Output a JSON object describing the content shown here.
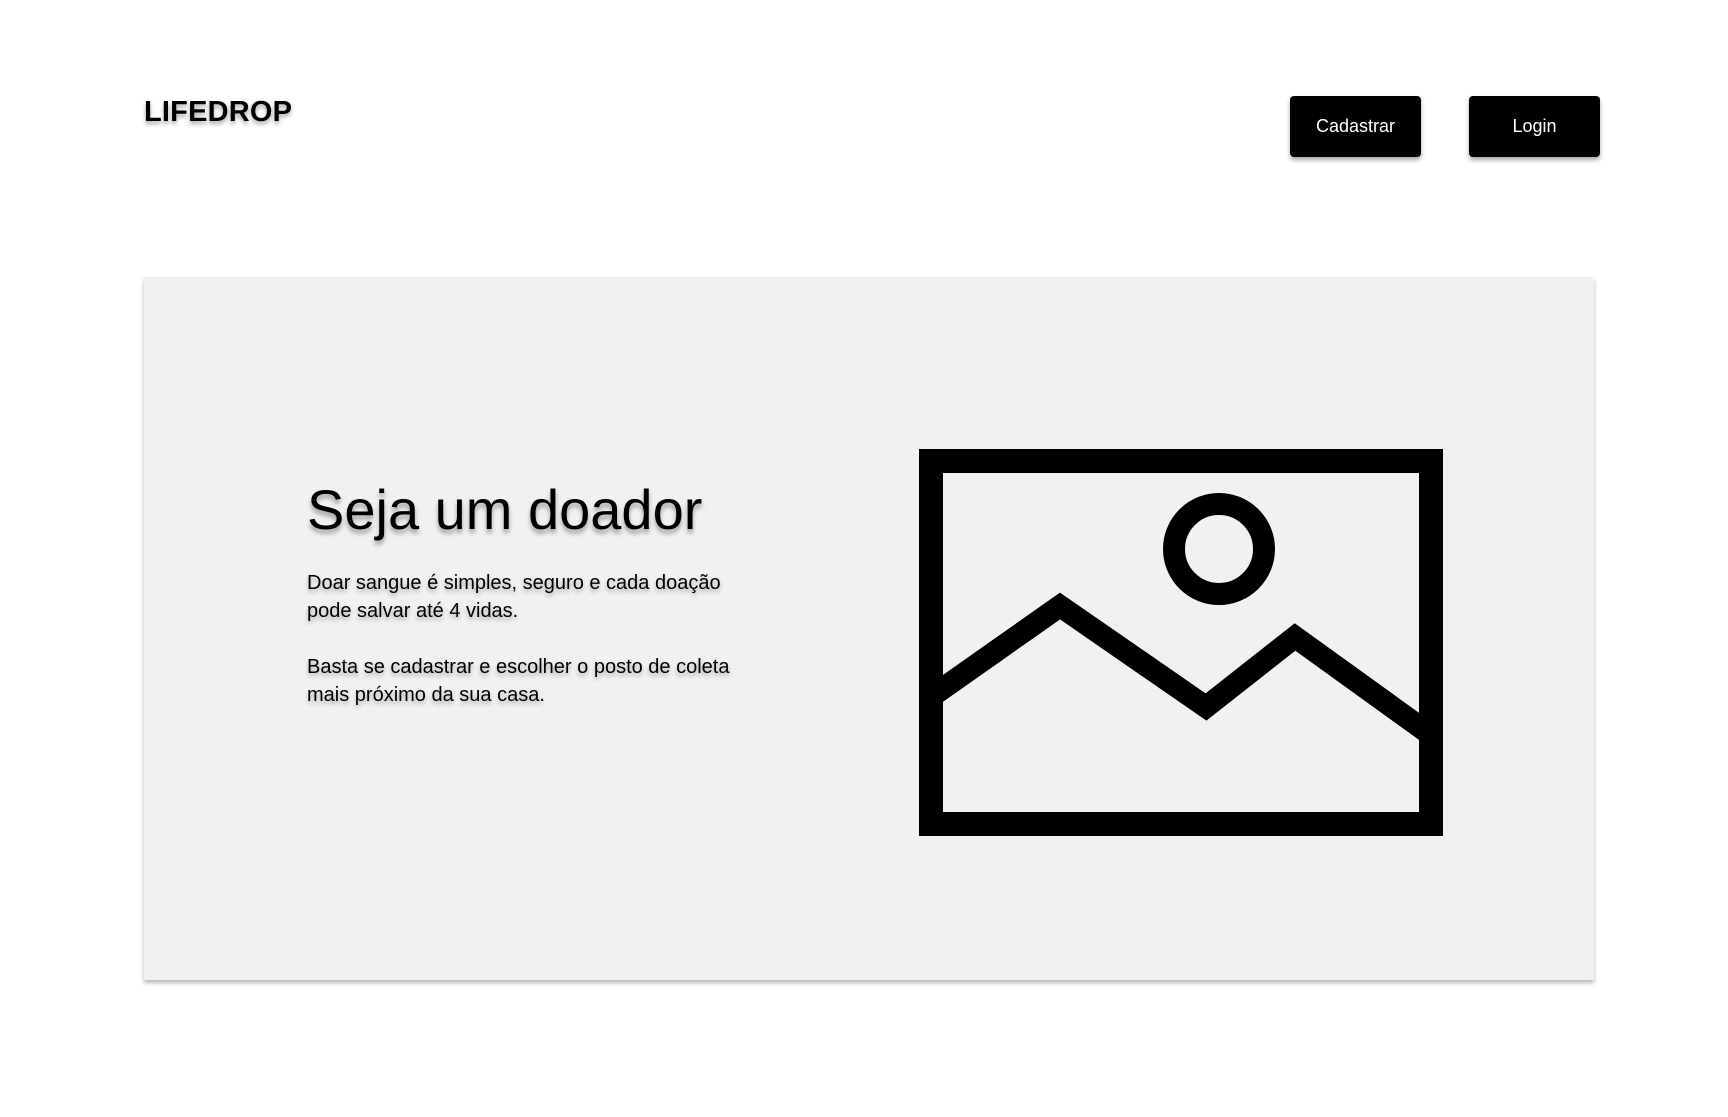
{
  "header": {
    "brand": "LIFEDROP",
    "register_label": "Cadastrar",
    "login_label": "Login"
  },
  "hero": {
    "title": "Seja um doador",
    "paragraph_1": "Doar sangue é simples, seguro e cada doação pode salvar até 4 vidas.",
    "paragraph_2": "Basta se cadastrar e escolher o posto de coleta mais próximo da sua casa.",
    "image_icon": "image-placeholder-icon"
  },
  "colors": {
    "background": "#ffffff",
    "panel": "#f1f1f1",
    "button": "#000000",
    "button_text": "#ffffff"
  }
}
